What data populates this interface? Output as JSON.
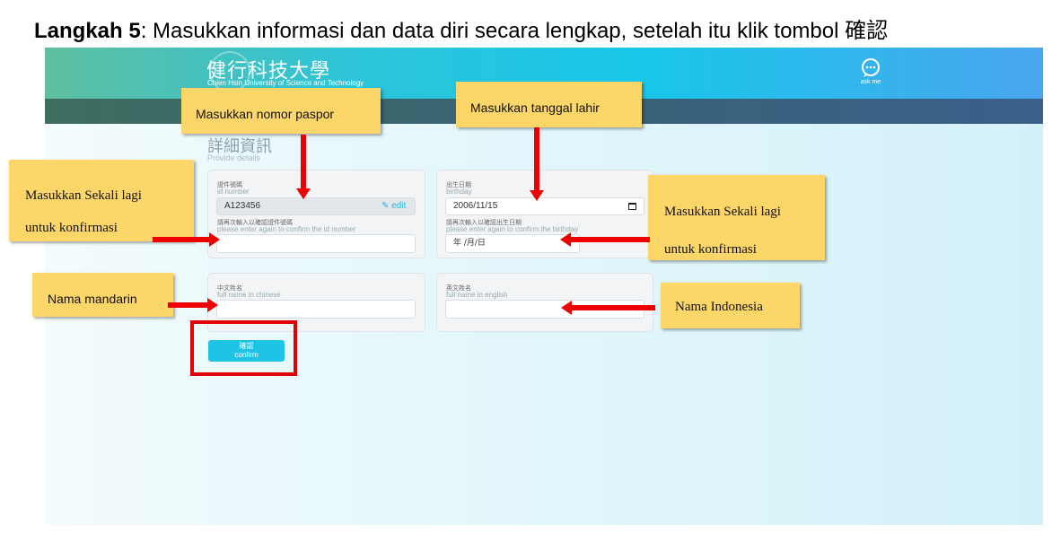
{
  "instruction": {
    "step_label": "Langkah 5",
    "text": ": Masukkan informasi dan data diri secara lengkap, setelah itu klik tombol ",
    "button_ref": "確認"
  },
  "header": {
    "logo_zh": "健行科技大學",
    "logo_en": "Chien Hsin University of Science and Technology",
    "ask_me": "ask me"
  },
  "page": {
    "title_zh": "詳細資訊",
    "title_en": "Provide details"
  },
  "id_card": {
    "label_zh": "證件號碼",
    "label_en": "id number",
    "value": "A123456",
    "edit": "edit",
    "confirm_label_zh": "請再次輸入以確認證件號碼",
    "confirm_label_en": "please enter again to confirm the id number",
    "confirm_value": ""
  },
  "birthday_card": {
    "label_zh": "出生日期",
    "label_en": "birthday",
    "value": "2006/11/15",
    "confirm_label_zh": "請再次輸入以確認出生日期",
    "confirm_label_en": "please enter again to confirm the birthday",
    "confirm_placeholder": "年 /月/日"
  },
  "chinese_name_card": {
    "label_zh": "中文姓名",
    "label_en": "full name in chinese",
    "value": ""
  },
  "english_name_card": {
    "label_zh": "英文姓名",
    "label_en": "full name in english",
    "value": ""
  },
  "confirm_button": {
    "label_zh": "確認",
    "label_en": "confirm"
  },
  "annotations": {
    "passport": "Masukkan nomor paspor",
    "birthdate": "Masukkan tanggal lahir",
    "reenter_left_line1": "Masukkan Sekali lagi",
    "reenter_left_line2": "untuk konfirmasi",
    "reenter_right_line1": "Masukkan Sekali lagi",
    "reenter_right_line2": "untuk konfirmasi",
    "mandarin_name": "Nama mandarin",
    "indonesian_name": "Nama Indonesia"
  },
  "colors": {
    "accent": "#1ec4e6",
    "annotation_bg": "#fdd66a",
    "arrow": "#ee0000"
  }
}
